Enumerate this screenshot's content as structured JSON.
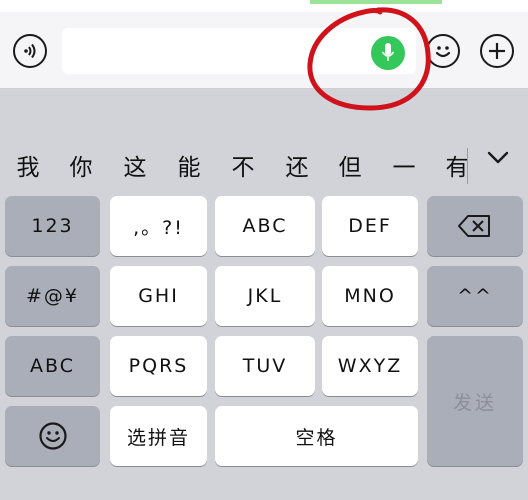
{
  "input_bar": {
    "voice_icon": "voice-waves-icon",
    "mic_icon": "microphone-icon",
    "emoji_icon": "smiley-icon",
    "plus_icon": "plus-icon",
    "mic_color": "#34c759",
    "annotation_color": "#d0121b"
  },
  "candidates": [
    "我",
    "你",
    "这",
    "能",
    "不",
    "还",
    "但",
    "一",
    "有"
  ],
  "candidates_toggle_icon": "chevron-down-icon",
  "keyboard": {
    "row1": [
      "123",
      ",。?!",
      "ABC",
      "DEF"
    ],
    "delete_icon": "backspace-icon",
    "row2": [
      "#@¥",
      "GHI",
      "JKL",
      "MNO",
      "^^"
    ],
    "row3": [
      "ABC",
      "PQRS",
      "TUV",
      "WXYZ"
    ],
    "send": "发送",
    "row4_emoji_icon": "smiley-icon",
    "pinyin": "选拼音",
    "space": "空格"
  }
}
